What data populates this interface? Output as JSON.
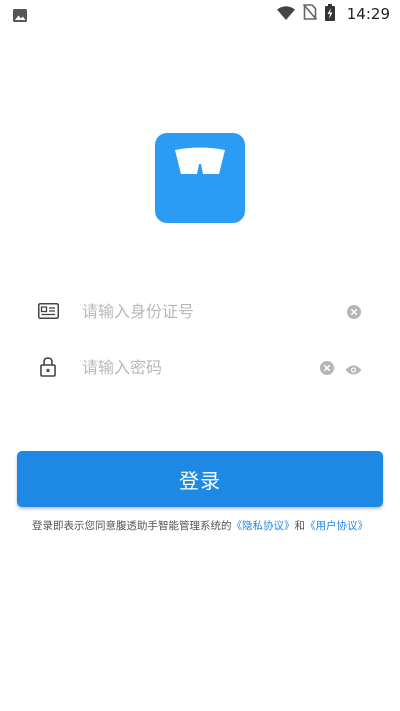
{
  "status_bar": {
    "time": "14:29",
    "icons": [
      "image-icon",
      "wifi-icon",
      "no-sim-icon",
      "battery-charging-icon"
    ]
  },
  "logo": {
    "icon": "scale-icon",
    "color": "#2b9bf4"
  },
  "form": {
    "id_field": {
      "placeholder": "请输入身份证号",
      "value": "",
      "icon": "id-card-icon"
    },
    "password_field": {
      "placeholder": "请输入密码",
      "value": "",
      "icon": "lock-icon"
    }
  },
  "login_button": {
    "label": "登录",
    "color": "#1e88e5"
  },
  "agreement": {
    "prefix": "登录即表示您同意腹透助手智能管理系统的",
    "privacy_link": "《隐私协议》",
    "and": "和",
    "user_link": "《用户协议》"
  }
}
